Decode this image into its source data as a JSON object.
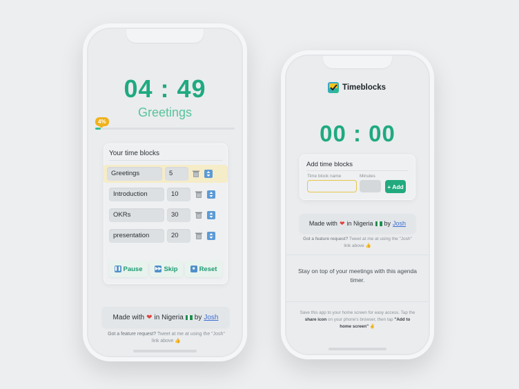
{
  "phone_left": {
    "timer": "04 : 49",
    "current_task": "Greetings",
    "progress_label": "4%",
    "progress_fraction": 0.04,
    "card_title": "Your time blocks",
    "blocks": [
      {
        "name": "Greetings",
        "minutes": "5"
      },
      {
        "name": "Introduction",
        "minutes": "10"
      },
      {
        "name": "OKRs",
        "minutes": "30"
      },
      {
        "name": "presentation",
        "minutes": "20"
      }
    ],
    "actions": {
      "pause": "Pause",
      "skip": "Skip",
      "reset": "Reset"
    },
    "made_with": {
      "prefix": "Made with",
      "middle": "in Nigeria",
      "by": "by",
      "author": "Josh"
    },
    "feature_note": {
      "part1": "Got a feature request?",
      "part2": " Tweet at me at using the \"Josh\" link above 👍"
    }
  },
  "phone_right": {
    "app_name": "Timeblocks",
    "timer": "00 : 00",
    "card_title": "Add time blocks",
    "name_label": "Time block name",
    "minutes_label": "Minutes",
    "add_button": "+ Add",
    "made_with": {
      "prefix": "Made with",
      "middle": "in Nigeria",
      "by": "by",
      "author": "Josh"
    },
    "feature_note": {
      "part1": "Got a feature request?",
      "part2": " Tweet at me at using the \"Josh\" link above 👍"
    },
    "agenda_tagline": "Stay on top of your meetings with this agenda timer.",
    "home_hint": {
      "part1": "Save this app to your home screen for easy access. Tap the ",
      "share_icon": "share icon",
      "part2": " on your phone's browser, then tap ",
      "add_home": "\"Add to home screen\"",
      "part3": " ✌"
    }
  },
  "colors": {
    "accent_green": "#1faa7f",
    "badge_yellow": "#f0b21c",
    "active_row": "#f5ecc8",
    "link_blue": "#3b6fd4"
  }
}
